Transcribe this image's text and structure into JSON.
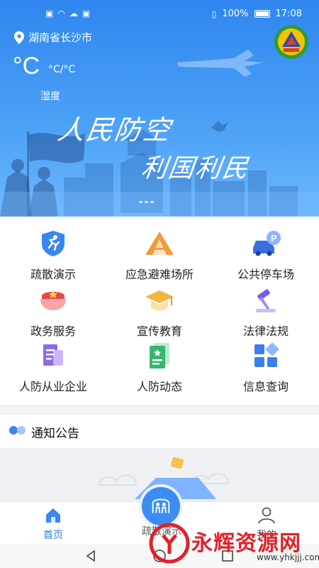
{
  "status_bar": {
    "battery": "100%",
    "time": "17:08"
  },
  "hero": {
    "location": "湖南省长沙市",
    "temp_unit_big": "°C",
    "temp_unit_small": "°C/°C",
    "humidity_label": "湿度",
    "slogan_line1": "人民防空",
    "slogan_line2": "利国利民"
  },
  "grid": [
    {
      "label": "疏散演示",
      "icon": "running-person-shield-icon"
    },
    {
      "label": "应急避难场所",
      "icon": "tent-icon"
    },
    {
      "label": "公共停车场",
      "icon": "parking-car-icon"
    },
    {
      "label": "政务服务",
      "icon": "official-cap-icon"
    },
    {
      "label": "宣传教育",
      "icon": "graduation-cap-icon"
    },
    {
      "label": "法律法规",
      "icon": "gavel-icon"
    },
    {
      "label": "人防从业企业",
      "icon": "enterprise-document-icon"
    },
    {
      "label": "人防动态",
      "icon": "news-document-icon"
    },
    {
      "label": "信息查询",
      "icon": "info-grid-icon"
    }
  ],
  "notice": {
    "title": "通知公告"
  },
  "bottom_nav": {
    "home": "首页",
    "center": "疏散演示",
    "mine": "我的"
  },
  "watermark": {
    "text": "永辉资源网",
    "url": "www.yhkjjj.com"
  },
  "colors": {
    "accent": "#2c7be5",
    "hero_top": "#2f86ee",
    "watermark_red": "#e0222b"
  }
}
